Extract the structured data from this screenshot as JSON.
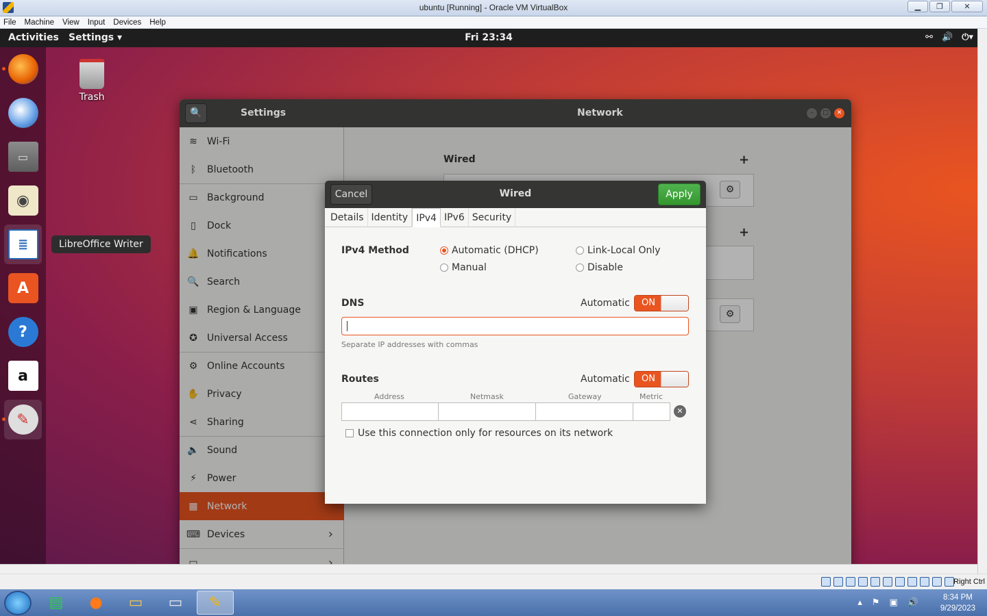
{
  "vbox": {
    "title": "ubuntu [Running] - Oracle VM VirtualBox",
    "menu": [
      "File",
      "Machine",
      "View",
      "Input",
      "Devices",
      "Help"
    ],
    "host_key": "Right Ctrl"
  },
  "topbar": {
    "activities": "Activities",
    "app_menu": "Settings ▾",
    "clock": "Fri 23:34"
  },
  "dock": {
    "tooltip": "LibreOffice Writer",
    "items": [
      "firefox-icon",
      "thunderbird-icon",
      "files-icon",
      "rhythmbox-icon",
      "libreoffice-writer-icon",
      "software-center-icon",
      "help-icon",
      "amazon-icon",
      "settings-icon"
    ]
  },
  "desktop": {
    "trash_label": "Trash"
  },
  "settings": {
    "title": "Settings",
    "panel_title": "Network",
    "sidebar": [
      {
        "label": "Wi-Fi",
        "icon": "wifi-icon"
      },
      {
        "label": "Bluetooth",
        "icon": "bluetooth-icon"
      },
      {
        "label": "Background",
        "icon": "background-icon"
      },
      {
        "label": "Dock",
        "icon": "dock-icon"
      },
      {
        "label": "Notifications",
        "icon": "bell-icon"
      },
      {
        "label": "Search",
        "icon": "search-icon"
      },
      {
        "label": "Region & Language",
        "icon": "region-icon"
      },
      {
        "label": "Universal Access",
        "icon": "accessibility-icon"
      },
      {
        "label": "Online Accounts",
        "icon": "online-accounts-icon"
      },
      {
        "label": "Privacy",
        "icon": "hand-icon"
      },
      {
        "label": "Sharing",
        "icon": "share-icon"
      },
      {
        "label": "Sound",
        "icon": "speaker-icon"
      },
      {
        "label": "Power",
        "icon": "power-icon"
      },
      {
        "label": "Network",
        "icon": "network-icon"
      },
      {
        "label": "Devices",
        "icon": "devices-icon"
      }
    ],
    "main": {
      "wired_label": "Wired",
      "partial_text": "ff"
    }
  },
  "dialog": {
    "title": "Wired",
    "cancel": "Cancel",
    "apply": "Apply",
    "tabs": [
      "Details",
      "Identity",
      "IPv4",
      "IPv6",
      "Security"
    ],
    "active_tab": "IPv4",
    "ipv4_method_label": "IPv4 Method",
    "methods": {
      "dhcp": "Automatic (DHCP)",
      "link_local": "Link-Local Only",
      "manual": "Manual",
      "disable": "Disable",
      "selected": "Automatic (DHCP)"
    },
    "dns": {
      "label": "DNS",
      "automatic_label": "Automatic",
      "toggle": "ON",
      "value": "",
      "hint": "Separate IP addresses with commas"
    },
    "routes": {
      "label": "Routes",
      "automatic_label": "Automatic",
      "toggle": "ON",
      "columns": [
        "Address",
        "Netmask",
        "Gateway",
        "Metric"
      ]
    },
    "only_resources": "Use this connection only for resources on its network"
  },
  "taskbar": {
    "time": "8:34 PM",
    "date": "9/29/2023"
  }
}
